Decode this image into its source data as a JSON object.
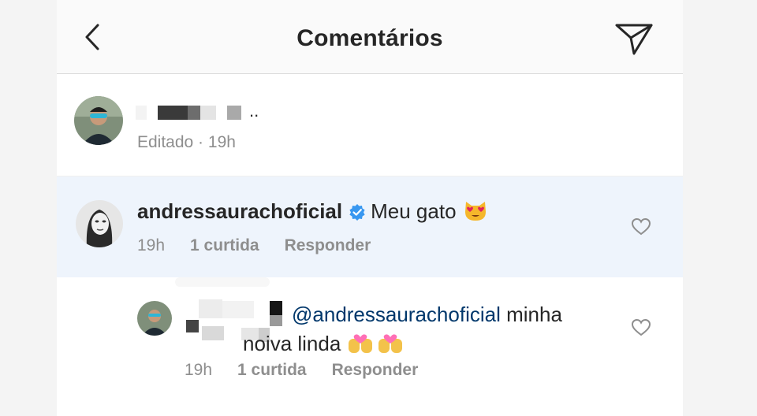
{
  "header": {
    "title": "Comentários"
  },
  "caption": {
    "meta": "Editado · 19h",
    "trailing": ".."
  },
  "comments": [
    {
      "username": "andressaurachoficial",
      "verified": true,
      "text": "Meu gato",
      "emoji": "heart-eyes-cat",
      "time": "19h",
      "likes": "1 curtida",
      "reply_label": "Responder"
    }
  ],
  "reply": {
    "mention": "@andressaurachoficial",
    "text": "minha",
    "text2": "noiva linda",
    "emoji": "kissing-couple-emoji",
    "time": "19h",
    "likes": "1 curtida",
    "reply_label": "Responder"
  },
  "colors": {
    "highlight": "#eef4fc",
    "verified": "#3897f0",
    "mention": "#00376b",
    "secondary": "#8e8e8e"
  }
}
